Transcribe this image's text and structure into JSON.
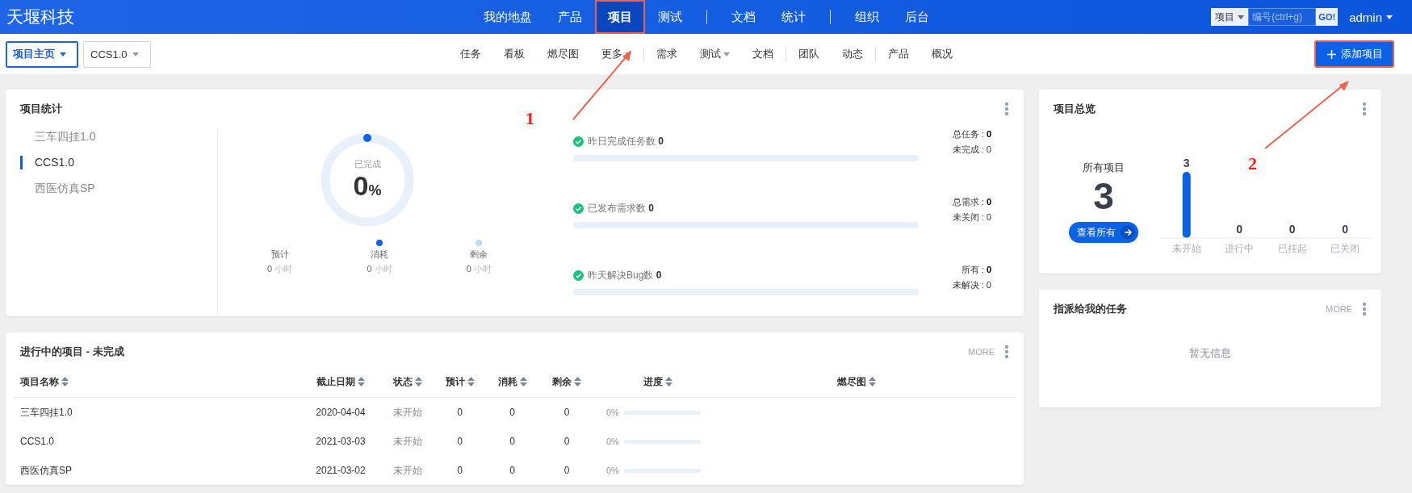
{
  "top_bar": {
    "brand": "天堰科技",
    "nav_groups": [
      [
        {
          "label": "我的地盘",
          "selected": false,
          "annotated": false
        },
        {
          "label": "产品",
          "selected": false,
          "annotated": false
        },
        {
          "label": "项目",
          "selected": true,
          "annotated": true
        },
        {
          "label": "测试",
          "selected": false,
          "annotated": false
        }
      ],
      [
        {
          "label": "文档",
          "selected": false,
          "annotated": false
        },
        {
          "label": "统计",
          "selected": false,
          "annotated": false
        }
      ],
      [
        {
          "label": "组织",
          "selected": false,
          "annotated": false
        },
        {
          "label": "后台",
          "selected": false,
          "annotated": false
        }
      ]
    ],
    "search": {
      "scope": "项目",
      "placeholder": "编号(ctrl+g)",
      "button": "GO!"
    },
    "user": "admin"
  },
  "sub_bar": {
    "breadcrumbs": [
      {
        "label": "项目主页",
        "selected": true
      },
      {
        "label": "CCS1.0",
        "selected": false
      }
    ],
    "menu_groups": [
      [
        {
          "label": "任务",
          "dropdown": false
        },
        {
          "label": "看板",
          "dropdown": false
        },
        {
          "label": "燃尽图",
          "dropdown": false
        },
        {
          "label": "更多",
          "dropdown": true
        }
      ],
      [
        {
          "label": "需求",
          "dropdown": false
        },
        {
          "label": "测试",
          "dropdown": true
        },
        {
          "label": "文档",
          "dropdown": false
        }
      ],
      [
        {
          "label": "团队",
          "dropdown": false
        },
        {
          "label": "动态",
          "dropdown": false
        }
      ],
      [
        {
          "label": "产品",
          "dropdown": false
        },
        {
          "label": "概况",
          "dropdown": false
        }
      ]
    ],
    "add_button": {
      "label": "添加项目",
      "annotated": true
    }
  },
  "project_stats": {
    "title": "项目统计",
    "projects": [
      {
        "label": "三车四挂1.0",
        "selected": false
      },
      {
        "label": "CCS1.0",
        "selected": true
      },
      {
        "label": "西医仿真SP",
        "selected": false
      }
    ],
    "completion": {
      "label": "已完成",
      "value": "0",
      "unit": "%",
      "level": 0
    },
    "hours": [
      {
        "label": "预计",
        "value": "0",
        "unit": "小时"
      },
      {
        "label": "消耗",
        "value": "0",
        "unit": "小时",
        "color": "#0b62e6"
      },
      {
        "label": "剩余",
        "value": "0",
        "unit": "小时",
        "color": "#c3d8f3"
      }
    ],
    "metrics": [
      {
        "label": "昨日完成任务数 **0**",
        "level": 0,
        "totals": [
          "总任务 : **0**",
          "未完成 : 0"
        ]
      },
      {
        "label": "已发布需求数 **0**",
        "level": 0,
        "totals": [
          "总需求 : **0**",
          "未关闭 : 0"
        ]
      },
      {
        "label": "昨天解决Bug数 **0**",
        "level": 0,
        "totals": [
          "所有 : **0**",
          "未解决 : 0"
        ]
      }
    ]
  },
  "ongoing_projects": {
    "title": "进行中的项目 - 未完成",
    "more": "MORE",
    "columns": [
      "项目名称",
      "截止日期",
      "状态",
      "预计",
      "消耗",
      "剩余",
      "进度",
      "燃尽图"
    ],
    "rows": [
      {
        "name": "三车四挂1.0",
        "deadline": "2020-04-04",
        "status": "未开始",
        "estimate": "0",
        "consumed": "0",
        "remaining": "0",
        "progress": "0%",
        "level": 0
      },
      {
        "name": "CCS1.0",
        "deadline": "2021-03-03",
        "status": "未开始",
        "estimate": "0",
        "consumed": "0",
        "remaining": "0",
        "progress": "0%",
        "level": 0
      },
      {
        "name": "西医仿真SP",
        "deadline": "2021-03-02",
        "status": "未开始",
        "estimate": "0",
        "consumed": "0",
        "remaining": "0",
        "progress": "0%",
        "level": 0
      }
    ]
  },
  "project_overview": {
    "title": "项目总览",
    "all_label": "所有项目",
    "all_count": "3",
    "view_all": "查看所有",
    "chart_data": {
      "type": "bar",
      "categories": [
        "未开始",
        "进行中",
        "已挂起",
        "已关闭"
      ],
      "values": [
        3,
        0,
        0,
        0
      ],
      "data_labels": true
    }
  },
  "assigned_tasks": {
    "title": "指派给我的任务",
    "more": "MORE",
    "empty": "暂无信息"
  },
  "annotations": [
    {
      "label": "1"
    },
    {
      "label": "2"
    }
  ]
}
